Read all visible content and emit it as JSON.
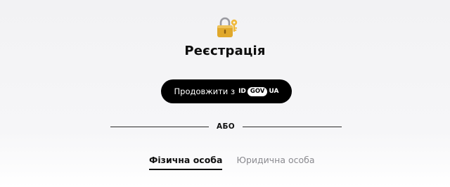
{
  "header": {
    "icon": "lock-with-key-icon",
    "title": "Реєстрація"
  },
  "id_button": {
    "label": "Продовжити з",
    "logo_id": "ID",
    "logo_gov": "GOV",
    "logo_ua": "UA"
  },
  "separator": {
    "label": "АБО"
  },
  "tabs": [
    {
      "label": "Фізична особа",
      "active": true
    },
    {
      "label": "Юридична особа",
      "active": false
    }
  ],
  "colors": {
    "button_bg": "#000000",
    "text_primary": "#111111",
    "text_muted": "#8a8a8f",
    "lock_gold": "#e0a82b"
  }
}
